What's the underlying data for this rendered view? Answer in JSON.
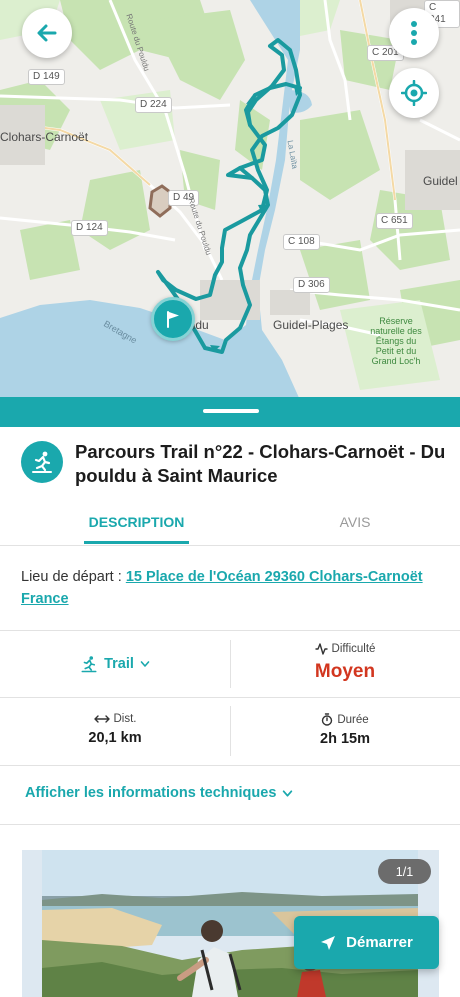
{
  "map": {
    "labels": {
      "d149": "D 149",
      "d224": "D 224",
      "d124": "D 124",
      "d49": "D 49",
      "c341": "C 341",
      "c201": "C 201",
      "c651": "C 651",
      "c108": "C 108",
      "d306": "D 306",
      "clohars": "Clohars-Carnoët",
      "guidel": "Guidel",
      "guidel_plages": "Guidel-Plages",
      "pouldu": "uldu",
      "bretagne": "Bretagne",
      "route_pouldu": "Route du Pouldu",
      "route_pouldu_2": "Route du Pouldu",
      "laita": "La Laïta",
      "reserve": "Réserve naturelle des Étangs du Petit et du Grand Loc'h"
    },
    "back_icon": "arrow-left-icon",
    "menu_icon": "vertical-dots-icon",
    "locate_icon": "crosshair-target-icon",
    "start_marker_icon": "flag-icon",
    "track_color": "#1a9a9f"
  },
  "sheet": {
    "activity_icon": "runner-icon",
    "title": "Parcours Trail n°22 - Clohars-Carnoët - Du pouldu à Saint Maurice",
    "tabs": [
      {
        "label": "DESCRIPTION",
        "active": true
      },
      {
        "label": "AVIS",
        "active": false
      }
    ],
    "depart": {
      "label": "Lieu de départ : ",
      "link": "15 Place de l'Océan 29360 Clohars-Carnoët France"
    },
    "stats": {
      "activity": {
        "value": "Trail",
        "icon": "runner-icon"
      },
      "difficulty": {
        "label": "Difficulté",
        "value": "Moyen",
        "icon": "pulse-icon",
        "color": "#d2361f"
      },
      "distance": {
        "label": "Dist.",
        "value": "20,1 km",
        "icon": "arrows-horizontal-icon"
      },
      "duration": {
        "label": "Durée",
        "value": "2h 15m",
        "icon": "stopwatch-icon"
      }
    },
    "tech_info_label": "Afficher les informations techniques",
    "photo": {
      "counter": "1/1"
    },
    "start_button": {
      "label": "Démarrer",
      "icon": "navigation-arrow-icon"
    }
  },
  "colors": {
    "accent": "#1aa8ad",
    "difficulty": "#d2361f"
  }
}
